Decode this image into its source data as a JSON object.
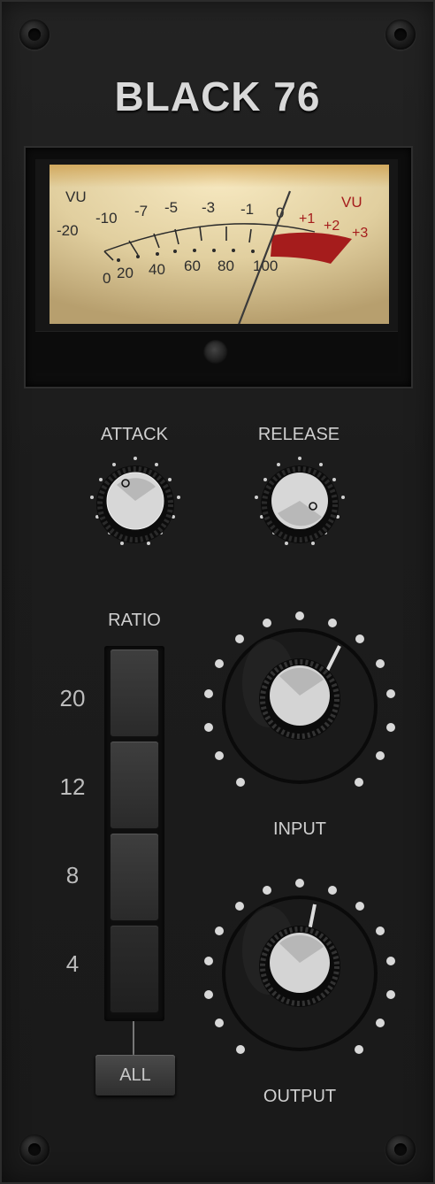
{
  "plugin": {
    "title": "BLACK 76"
  },
  "meter": {
    "vu_left": "VU",
    "vu_right": "VU",
    "db_scale": [
      "-20",
      "-10",
      "-7",
      "-5",
      "-3",
      "-1",
      "0",
      "+1",
      "+2",
      "+3"
    ],
    "percent_scale": [
      "0",
      "20",
      "40",
      "60",
      "80",
      "100"
    ],
    "needle_reading_db": 0
  },
  "controls": {
    "attack": {
      "label": "ATTACK"
    },
    "release": {
      "label": "RELEASE"
    },
    "input": {
      "label": "INPUT"
    },
    "output": {
      "label": "OUTPUT"
    }
  },
  "ratio": {
    "label": "RATIO",
    "options": [
      "20",
      "12",
      "8",
      "4"
    ],
    "all_label": "ALL",
    "selected": "4"
  },
  "colors": {
    "panel": "#1c1c1c",
    "meter_face": "#e8d9b0",
    "meter_red": "#a51c1c",
    "label_text": "#cfcfcf"
  }
}
